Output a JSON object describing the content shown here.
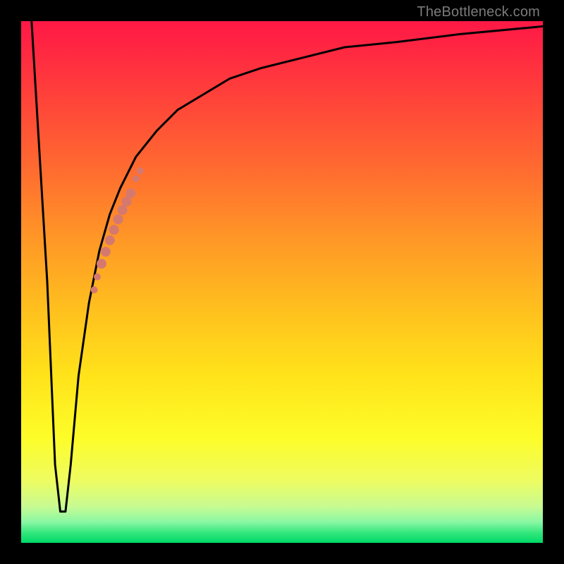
{
  "attribution": "TheBottleneck.com",
  "colors": {
    "frame": "#000000",
    "curve": "#000000",
    "markers": "#d5796f",
    "gradient_top": "#ff1846",
    "gradient_bottom": "#00d968"
  },
  "chart_data": {
    "type": "line",
    "title": "",
    "xlabel": "",
    "ylabel": "",
    "xlim": [
      0,
      100
    ],
    "ylim": [
      0,
      100
    ],
    "grid": false,
    "series": [
      {
        "name": "bottleneck-curve",
        "x": [
          2,
          5,
          6.5,
          7.5,
          8.5,
          9.5,
          11,
          13,
          15,
          17,
          19,
          22,
          26,
          30,
          35,
          40,
          46,
          54,
          62,
          72,
          84,
          100
        ],
        "values": [
          100,
          50,
          15,
          6,
          6,
          15,
          32,
          46,
          56,
          63,
          68,
          74,
          79,
          83,
          86,
          89,
          91,
          93,
          95,
          96,
          97.5,
          99
        ]
      }
    ],
    "markers": {
      "name": "highlighted-segment",
      "x": [
        14.0,
        14.6,
        15.4,
        16.2,
        17.0,
        17.8,
        18.6,
        19.4,
        20.2,
        21.0,
        22.0,
        22.8
      ],
      "values": [
        48.5,
        51.0,
        53.5,
        55.8,
        58.0,
        60.0,
        62.0,
        63.8,
        65.4,
        67.0,
        69.8,
        71.3
      ],
      "radius_px": [
        5,
        5,
        7,
        7,
        7,
        7,
        7,
        7,
        7,
        7,
        5,
        5
      ]
    }
  }
}
